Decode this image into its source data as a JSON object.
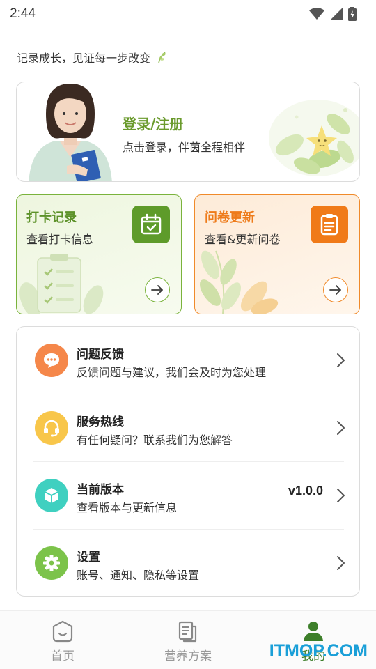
{
  "status_bar": {
    "time": "2:44"
  },
  "slogan": "记录成长，见证每一步改变",
  "login": {
    "title": "登录/注册",
    "subtitle": "点击登录，伴茵全程相伴"
  },
  "cards": [
    {
      "title": "打卡记录",
      "subtitle": "查看打卡信息",
      "icon": "calendar-check-icon",
      "color": "#5e9b2a"
    },
    {
      "title": "问卷更新",
      "subtitle": "查看&更新问卷",
      "icon": "clipboard-icon",
      "color": "#f07a18"
    }
  ],
  "menu": [
    {
      "title": "问题反馈",
      "subtitle": "反馈问题与建议，我们会及时为您处理",
      "icon": "chat-bubble-icon",
      "color": "#f5874a"
    },
    {
      "title": "服务热线",
      "subtitle": "有任何疑问？联系我们为您解答",
      "icon": "headset-icon",
      "color": "#f8c64a"
    },
    {
      "title": "当前版本",
      "subtitle": "查看版本与更新信息",
      "value": "v1.0.0",
      "icon": "cube-icon",
      "color": "#3fd0c0"
    },
    {
      "title": "设置",
      "subtitle": "账号、通知、隐私等设置",
      "icon": "gear-icon",
      "color": "#7cc34a"
    }
  ],
  "nav": [
    {
      "label": "首页",
      "icon": "home-face-icon"
    },
    {
      "label": "营养方案",
      "icon": "document-icon"
    },
    {
      "label": "我的",
      "icon": "person-icon",
      "active": true
    }
  ],
  "watermark": "ITMOP.COM"
}
